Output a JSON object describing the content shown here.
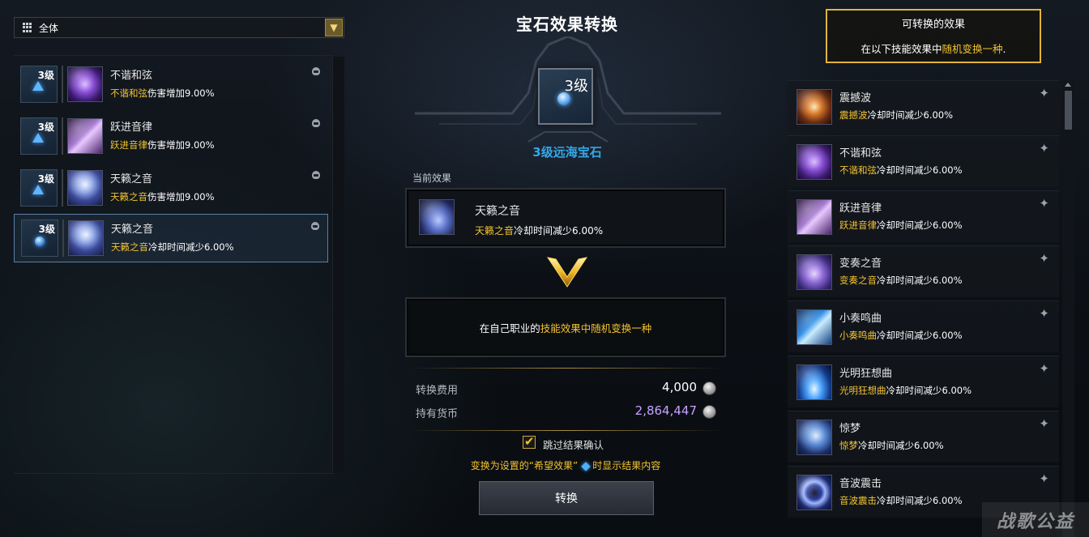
{
  "filter": {
    "label": "全体",
    "chevron_icon": "chevron-down-icon"
  },
  "left_list": {
    "items": [
      {
        "level": "3级",
        "name": "不谐和弦",
        "desc_highlight": "不谐和弦",
        "desc_rest": "伤害增加9.00%"
      },
      {
        "level": "3级",
        "name": "跃进音律",
        "desc_highlight": "跃进音律",
        "desc_rest": "伤害增加9.00%"
      },
      {
        "level": "3级",
        "name": "天籁之音",
        "desc_highlight": "天籁之音",
        "desc_rest": "伤害增加9.00%"
      },
      {
        "level": "3级",
        "name": "天籁之音",
        "desc_highlight": "天籁之音",
        "desc_rest": "冷却时间减少6.00%"
      }
    ]
  },
  "center": {
    "title": "宝石效果转换",
    "gem_level": "3级",
    "gem_name": "3级远海宝石",
    "current_effect_label": "当前效果",
    "current_effect": {
      "name": "天籁之音",
      "desc_highlight": "天籁之音",
      "desc_rest": "冷却时间减少6.00%"
    },
    "info_prefix": "在自己职业的",
    "info_highlight": "技能效果中随机变换一种",
    "cost_label": "转换费用",
    "cost_value": "4,000",
    "owned_label": "持有货币",
    "owned_value": "2,864,447",
    "skip_label": "跳过结果确认",
    "skip_checked": true,
    "note_before": "变换为设置的“希望效果”",
    "note_after": "时显示结果内容",
    "convert_button": "转换"
  },
  "right_panel": {
    "header_title": "可转换的效果",
    "header_prefix": "在以下技能效果中",
    "header_highlight": "随机变换一种",
    "header_suffix": ".",
    "items": [
      {
        "name": "震撼波",
        "desc_highlight": "震撼波",
        "desc_rest": "冷却时间减少6.00%"
      },
      {
        "name": "不谐和弦",
        "desc_highlight": "不谐和弦",
        "desc_rest": "冷却时间减少6.00%"
      },
      {
        "name": "跃进音律",
        "desc_highlight": "跃进音律",
        "desc_rest": "冷却时间减少6.00%"
      },
      {
        "name": "变奏之音",
        "desc_highlight": "变奏之音",
        "desc_rest": "冷却时间减少6.00%"
      },
      {
        "name": "小奏鸣曲",
        "desc_highlight": "小奏鸣曲",
        "desc_rest": "冷却时间减少6.00%"
      },
      {
        "name": "光明狂想曲",
        "desc_highlight": "光明狂想曲",
        "desc_rest": "冷却时间减少6.00%"
      },
      {
        "name": "惊梦",
        "desc_highlight": "惊梦",
        "desc_rest": "冷却时间减少6.00%"
      },
      {
        "name": "音波震击",
        "desc_highlight": "音波震击",
        "desc_rest": "冷却时间减少6.00%"
      }
    ]
  },
  "watermark": "战歌公益",
  "colors": {
    "highlight": "#f2c230",
    "gem_name": "#33a8e8",
    "owned_currency": "#c7a2ff",
    "header_border": "#e0b33a"
  }
}
